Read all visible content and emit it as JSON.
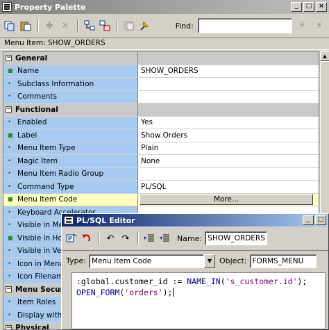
{
  "palette": {
    "title": "Property Palette",
    "window_buttons": [
      "_",
      "□",
      "×"
    ],
    "toolbar_icons": [
      "copy-icon",
      "paste-icon",
      "add-icon",
      "delete-icon",
      "intersection-icon",
      "union-icon",
      "inherit-icon",
      "freeze-icon"
    ],
    "find_label": "Find:",
    "find_value": "",
    "context": "Menu Item: SHOW_ORDERS",
    "more_label": "More..."
  },
  "sections": [
    {
      "label": "General",
      "toggle": "−"
    },
    {
      "label": "Functional",
      "toggle": "−"
    },
    {
      "label": "Menu Securi",
      "toggle": "−"
    },
    {
      "label": "Physical",
      "toggle": "−"
    }
  ],
  "props": [
    {
      "name": "Name",
      "value": "SHOW_ORDERS",
      "changed": true
    },
    {
      "name": "Subclass Information",
      "value": "",
      "changed": false
    },
    {
      "name": "Comments",
      "value": "",
      "changed": false
    },
    {
      "name": "Enabled",
      "value": "Yes",
      "changed": false
    },
    {
      "name": "Label",
      "value": "Show Orders",
      "changed": true
    },
    {
      "name": "Menu Item Type",
      "value": "Plain",
      "changed": false
    },
    {
      "name": "Magic Item",
      "value": "None",
      "changed": false
    },
    {
      "name": "Menu Item Radio Group",
      "value": "",
      "changed": false
    },
    {
      "name": "Command Type",
      "value": "PL/SQL",
      "changed": false
    },
    {
      "name": "Menu Item Code",
      "value": "",
      "changed": true
    },
    {
      "name": "Keyboard Accelerator",
      "value": "",
      "changed": false
    },
    {
      "name": "Visible in Mer",
      "value": "",
      "changed": false
    },
    {
      "name": "Visible in Hor",
      "value": "",
      "changed": true
    },
    {
      "name": "Visible in Ver",
      "value": "",
      "changed": false
    },
    {
      "name": "Icon in Menu",
      "value": "",
      "changed": false
    },
    {
      "name": "Icon Filenam",
      "value": "",
      "changed": false
    },
    {
      "name": "Item Roles",
      "value": "",
      "changed": false
    },
    {
      "name": "Display witho",
      "value": "",
      "changed": false
    }
  ],
  "editor": {
    "title": "PL/SQL Editor",
    "window_buttons": [
      "_",
      "□"
    ],
    "name_label": "Name:",
    "name_value": "SHOW_ORDERS",
    "type_label": "Type:",
    "type_value": "Menu Item Code",
    "object_label": "Object:",
    "object_value": "FORMS_MENU",
    "code": {
      "l1_a": ":global.customer_id := ",
      "l1_b": "NAME_IN",
      "l1_c": "(",
      "l1_d": "'s_customer.id'",
      "l1_e": ");",
      "l2_a": "OPEN_FORM",
      "l2_b": "(",
      "l2_c": "'orders'",
      "l2_d": ");"
    }
  }
}
